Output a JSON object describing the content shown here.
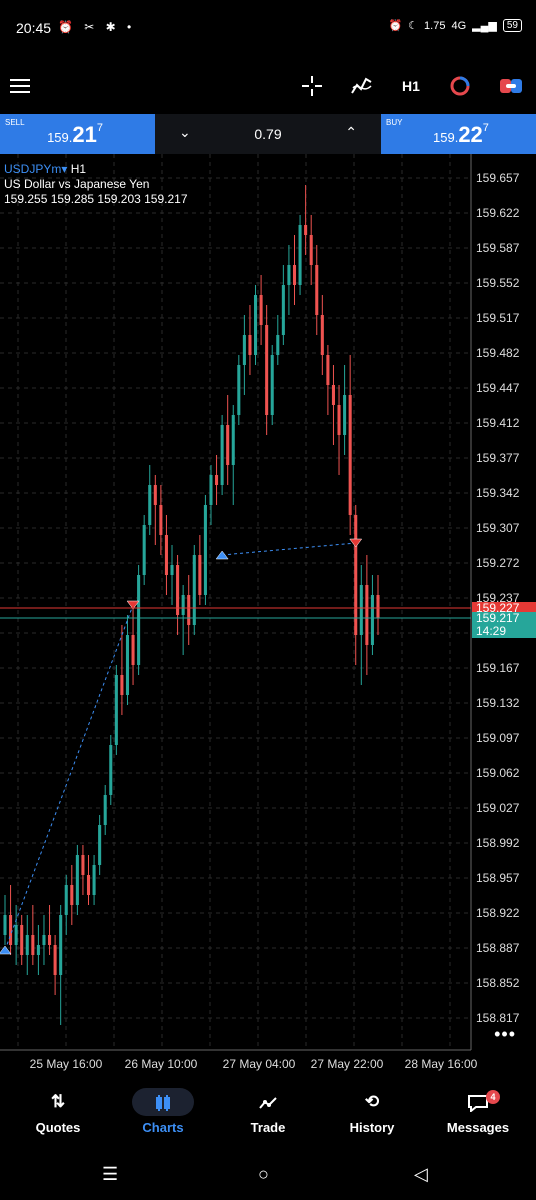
{
  "status_bar": {
    "time": "20:45",
    "left_icons": "⏰ ✂ ✱ •",
    "net_speed": "1.75",
    "signal": "4G",
    "battery": "59"
  },
  "toolbar": {
    "menu_icon": "hamburger-icon",
    "crosshair_icon": "crosshair-icon",
    "indicators_icon": "indicators-icon",
    "timeframe": "H1",
    "objects_icon": "objects-icon",
    "trade_icon": "trade-icon"
  },
  "trade_bar": {
    "sell_label": "SELL",
    "sell_price_prefix": "159.",
    "sell_price_big": "21",
    "sell_price_sup": "7",
    "lot": "0.79",
    "buy_label": "BUY",
    "buy_price_prefix": "159.",
    "buy_price_big": "22",
    "buy_price_sup": "7"
  },
  "chart": {
    "symbol": "USDJPYm",
    "symbol_arrow": "▾",
    "timeframe": "H1",
    "description": "US Dollar vs Japanese Yen",
    "ohlc": "159.255 159.285 159.203 159.217",
    "ask_label": "159.227",
    "bid_label": "159.217",
    "countdown": "14:29",
    "colors": {
      "bull": "#26a69a",
      "bear": "#ef5350",
      "ask_line": "#e53935",
      "bid_line": "#26a69a",
      "grid": "#2a2a2a"
    }
  },
  "chart_data": {
    "type": "candlestick",
    "y_ticks": [
      "159.657",
      "159.622",
      "159.587",
      "159.552",
      "159.517",
      "159.482",
      "159.447",
      "159.412",
      "159.377",
      "159.342",
      "159.307",
      "159.272",
      "159.237",
      "159.202",
      "159.167",
      "159.132",
      "159.097",
      "159.062",
      "159.027",
      "158.992",
      "158.957",
      "158.922",
      "158.887",
      "158.852",
      "158.817"
    ],
    "x_ticks": [
      "25 May 16:00",
      "26 May 10:00",
      "27 May 04:00",
      "27 May 22:00",
      "28 May 16:00"
    ],
    "ylim": [
      158.8,
      159.67
    ],
    "candles": [
      [
        158.9,
        158.94,
        158.89,
        158.92
      ],
      [
        158.92,
        158.95,
        158.88,
        158.89
      ],
      [
        158.89,
        158.93,
        158.87,
        158.91
      ],
      [
        158.91,
        158.92,
        158.87,
        158.88
      ],
      [
        158.88,
        158.92,
        158.86,
        158.9
      ],
      [
        158.9,
        158.93,
        158.87,
        158.88
      ],
      [
        158.88,
        158.91,
        158.86,
        158.89
      ],
      [
        158.89,
        158.92,
        158.87,
        158.9
      ],
      [
        158.9,
        158.93,
        158.88,
        158.89
      ],
      [
        158.89,
        158.9,
        158.84,
        158.86
      ],
      [
        158.86,
        158.93,
        158.81,
        158.92
      ],
      [
        158.92,
        158.96,
        158.9,
        158.95
      ],
      [
        158.95,
        158.97,
        158.91,
        158.93
      ],
      [
        158.93,
        158.99,
        158.92,
        158.98
      ],
      [
        158.98,
        158.99,
        158.94,
        158.96
      ],
      [
        158.96,
        158.98,
        158.93,
        158.94
      ],
      [
        158.94,
        158.98,
        158.93,
        158.97
      ],
      [
        158.97,
        159.02,
        158.96,
        159.01
      ],
      [
        159.01,
        159.05,
        159.0,
        159.04
      ],
      [
        159.04,
        159.1,
        159.03,
        159.09
      ],
      [
        159.09,
        159.17,
        159.08,
        159.16
      ],
      [
        159.16,
        159.21,
        159.12,
        159.14
      ],
      [
        159.14,
        159.22,
        159.13,
        159.2
      ],
      [
        159.2,
        159.23,
        159.15,
        159.17
      ],
      [
        159.17,
        159.27,
        159.16,
        159.26
      ],
      [
        159.26,
        159.32,
        159.25,
        159.31
      ],
      [
        159.31,
        159.37,
        159.3,
        159.35
      ],
      [
        159.35,
        159.36,
        159.29,
        159.33
      ],
      [
        159.33,
        159.35,
        159.28,
        159.3
      ],
      [
        159.3,
        159.32,
        159.24,
        159.26
      ],
      [
        159.26,
        159.29,
        159.23,
        159.27
      ],
      [
        159.27,
        159.28,
        159.2,
        159.22
      ],
      [
        159.22,
        159.25,
        159.18,
        159.24
      ],
      [
        159.24,
        159.26,
        159.19,
        159.21
      ],
      [
        159.21,
        159.29,
        159.2,
        159.28
      ],
      [
        159.28,
        159.3,
        159.23,
        159.24
      ],
      [
        159.24,
        159.34,
        159.23,
        159.33
      ],
      [
        159.33,
        159.37,
        159.31,
        159.36
      ],
      [
        159.36,
        159.38,
        159.33,
        159.35
      ],
      [
        159.35,
        159.42,
        159.34,
        159.41
      ],
      [
        159.41,
        159.44,
        159.35,
        159.37
      ],
      [
        159.37,
        159.43,
        159.33,
        159.42
      ],
      [
        159.42,
        159.48,
        159.41,
        159.47
      ],
      [
        159.47,
        159.52,
        159.44,
        159.5
      ],
      [
        159.5,
        159.53,
        159.46,
        159.48
      ],
      [
        159.48,
        159.55,
        159.47,
        159.54
      ],
      [
        159.54,
        159.56,
        159.49,
        159.51
      ],
      [
        159.51,
        159.53,
        159.4,
        159.42
      ],
      [
        159.42,
        159.49,
        159.41,
        159.48
      ],
      [
        159.48,
        159.52,
        159.47,
        159.5
      ],
      [
        159.5,
        159.57,
        159.49,
        159.55
      ],
      [
        159.55,
        159.59,
        159.52,
        159.57
      ],
      [
        159.57,
        159.6,
        159.53,
        159.55
      ],
      [
        159.55,
        159.62,
        159.54,
        159.61
      ],
      [
        159.61,
        159.65,
        159.58,
        159.6
      ],
      [
        159.6,
        159.62,
        159.55,
        159.57
      ],
      [
        159.57,
        159.59,
        159.5,
        159.52
      ],
      [
        159.52,
        159.54,
        159.46,
        159.48
      ],
      [
        159.48,
        159.49,
        159.42,
        159.45
      ],
      [
        159.45,
        159.47,
        159.39,
        159.43
      ],
      [
        159.43,
        159.45,
        159.36,
        159.4
      ],
      [
        159.4,
        159.47,
        159.38,
        159.44
      ],
      [
        159.44,
        159.48,
        159.3,
        159.32
      ],
      [
        159.32,
        159.33,
        159.17,
        159.2
      ],
      [
        159.2,
        159.27,
        159.15,
        159.25
      ],
      [
        159.25,
        159.28,
        159.16,
        159.19
      ],
      [
        159.19,
        159.26,
        159.18,
        159.24
      ],
      [
        159.24,
        159.26,
        159.2,
        159.217
      ]
    ],
    "trade_markers": [
      {
        "type": "buy",
        "candle": 0,
        "price": 158.885
      },
      {
        "type": "sell",
        "candle": 23,
        "price": 159.23
      },
      {
        "type": "buy",
        "candle": 39,
        "price": 159.28
      },
      {
        "type": "sell",
        "candle": 63,
        "price": 159.292
      }
    ]
  },
  "bottom_nav": {
    "items": [
      {
        "label": "Quotes",
        "icon": "quotes-icon"
      },
      {
        "label": "Charts",
        "icon": "charts-icon"
      },
      {
        "label": "Trade",
        "icon": "trade-line-icon"
      },
      {
        "label": "History",
        "icon": "history-icon"
      },
      {
        "label": "Messages",
        "icon": "messages-icon"
      }
    ],
    "messages_badge": "4",
    "active": "Charts"
  }
}
